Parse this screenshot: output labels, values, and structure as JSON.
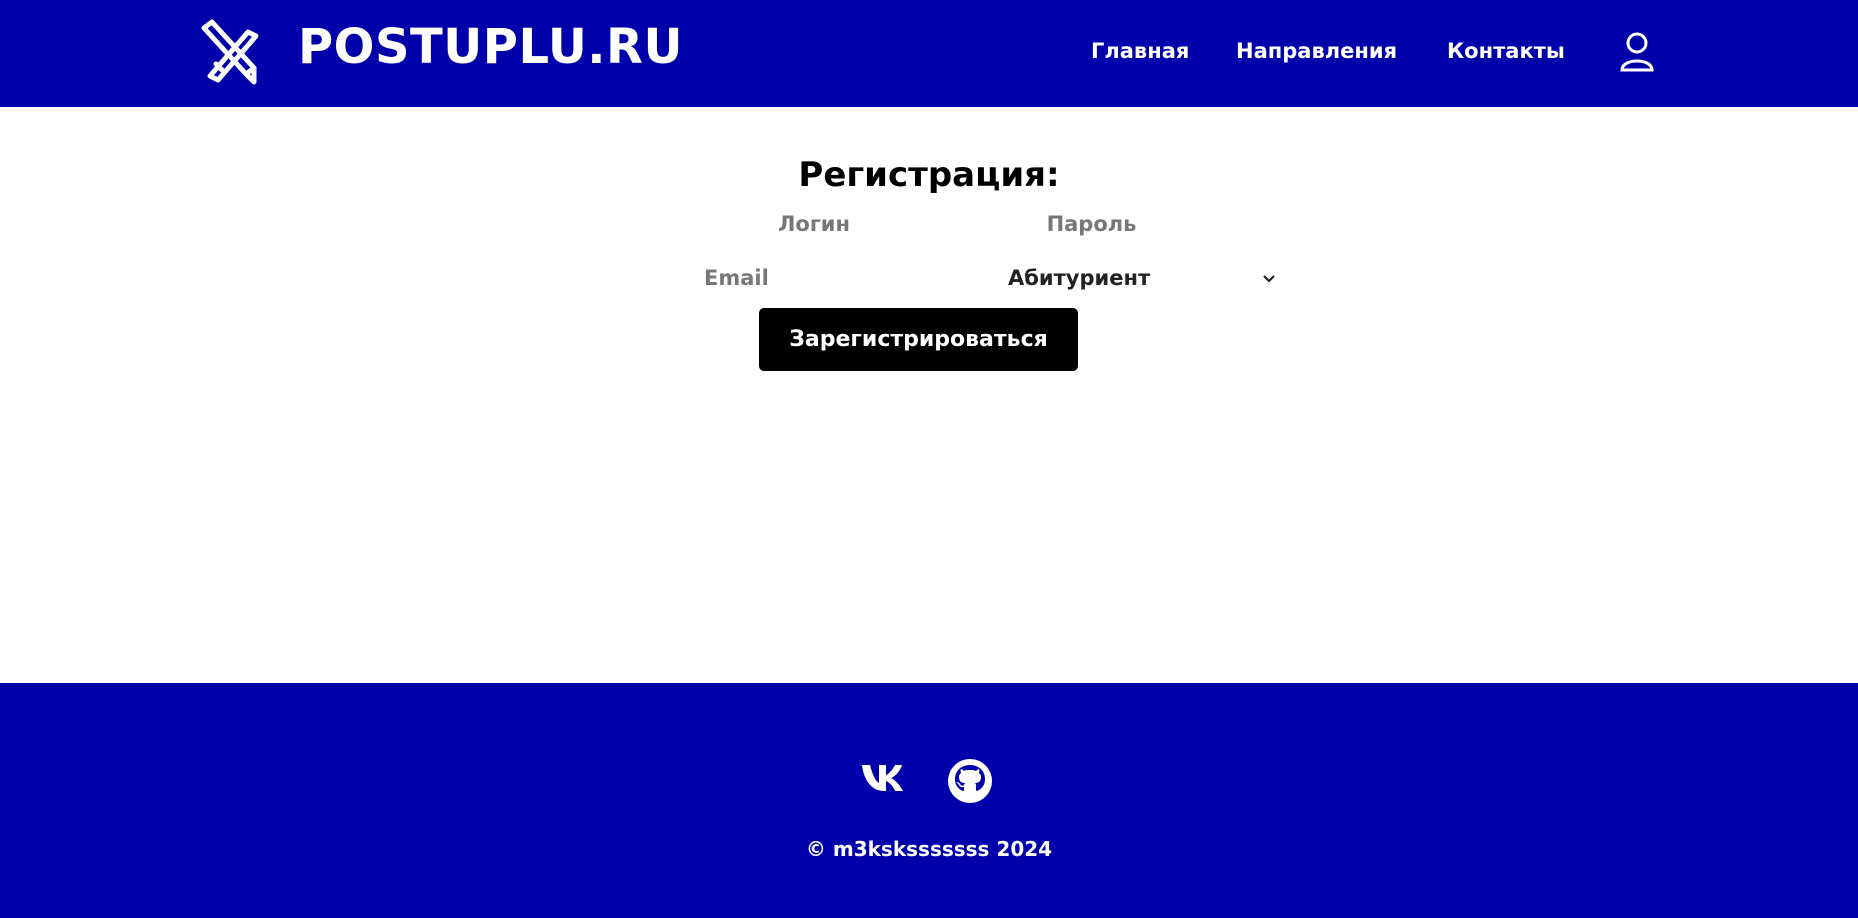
{
  "header": {
    "brand": "POSTUPLU.RU",
    "nav": {
      "home": "Главная",
      "directions": "Направления",
      "contacts": "Контакты"
    },
    "logo_icon": "crossed-pencil-ruler-icon",
    "profile_icon": "user-icon"
  },
  "form": {
    "title": "Регистрация:",
    "login_placeholder": "Логин",
    "password_placeholder": "Пароль",
    "email_placeholder": "Email",
    "role_selected": "Абитуриент",
    "submit_label": "Зарегистрироваться"
  },
  "footer": {
    "social_icons": [
      "vk-icon",
      "github-icon"
    ],
    "copyright": "© m3ksksssssss 2024"
  },
  "colors": {
    "brand_blue": "#0000aa",
    "button_black": "#000000",
    "text_white": "#ffffff",
    "placeholder_gray": "#777777"
  }
}
